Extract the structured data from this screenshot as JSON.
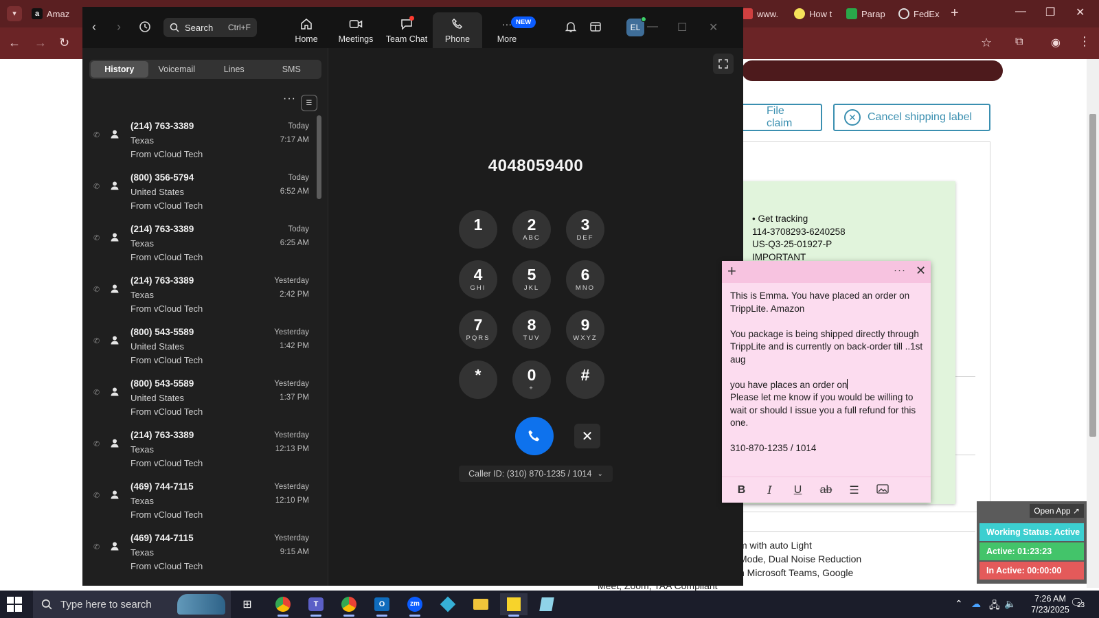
{
  "browser": {
    "tabs": [
      {
        "label": "Amaz",
        "color": "#111111"
      },
      {
        "label": "www.",
        "color": "#d04040"
      },
      {
        "label": "How t",
        "color": "#f5e25a"
      },
      {
        "label": "Parap",
        "color": "#2aa84a"
      },
      {
        "label": "FedEx",
        "color": "#e0e0e0"
      }
    ],
    "new_tab_label": "+"
  },
  "background_page": {
    "file_claim_label": "File claim",
    "cancel_label_btn": "Cancel shipping label",
    "features": [
      "m with auto Light",
      "Mode, Dual Noise Reduction",
      "h Microsoft Teams, Google"
    ],
    "bottom_text": "Meet, Zoom, TAA Compliant"
  },
  "green_note": {
    "lines": [
      "• Get tracking",
      "114-3708293-6240258",
      "US-Q3-25-01927-P",
      "IMPORTANT"
    ]
  },
  "status_widget": {
    "open_app": "Open App ↗",
    "working_status": "Working Status: Active",
    "active": "Active: 01:23:23",
    "inactive": "In Active: 00:00:00",
    "colors": {
      "working": "#3ccfd0",
      "active": "#43c46a",
      "inactive": "#e45a5a"
    }
  },
  "zoom": {
    "search_label": "Search",
    "search_shortcut": "Ctrl+F",
    "nav": [
      {
        "label": "Home"
      },
      {
        "label": "Meetings"
      },
      {
        "label": "Team Chat"
      },
      {
        "label": "Phone"
      },
      {
        "label": "More"
      }
    ],
    "new_badge": "NEW",
    "avatar_initials": "EL",
    "tabs": [
      "History",
      "Voicemail",
      "Lines",
      "SMS"
    ],
    "history": [
      {
        "number": "(214) 763-3389",
        "location": "Texas",
        "from": "From vCloud Tech",
        "day": "Today",
        "time": "7:17 AM"
      },
      {
        "number": "(800) 356-5794",
        "location": "United States",
        "from": "From vCloud Tech",
        "day": "Today",
        "time": "6:52 AM"
      },
      {
        "number": "(214) 763-3389",
        "location": "Texas",
        "from": "From vCloud Tech",
        "day": "Today",
        "time": "6:25 AM"
      },
      {
        "number": "(214) 763-3389",
        "location": "Texas",
        "from": "From vCloud Tech",
        "day": "Yesterday",
        "time": "2:42 PM"
      },
      {
        "number": "(800) 543-5589",
        "location": "United States",
        "from": "From vCloud Tech",
        "day": "Yesterday",
        "time": "1:42 PM"
      },
      {
        "number": "(800) 543-5589",
        "location": "United States",
        "from": "From vCloud Tech",
        "day": "Yesterday",
        "time": "1:37 PM"
      },
      {
        "number": "(214) 763-3389",
        "location": "Texas",
        "from": "From vCloud Tech",
        "day": "Yesterday",
        "time": "12:13 PM"
      },
      {
        "number": "(469) 744-7115",
        "location": "Texas",
        "from": "From vCloud Tech",
        "day": "Yesterday",
        "time": "12:10 PM"
      },
      {
        "number": "(469) 744-7115",
        "location": "Texas",
        "from": "From vCloud Tech",
        "day": "Yesterday",
        "time": "9:15 AM"
      }
    ],
    "dialer": {
      "number": "4048059400",
      "keys": [
        {
          "digit": "1",
          "letters": ""
        },
        {
          "digit": "2",
          "letters": "ABC"
        },
        {
          "digit": "3",
          "letters": "DEF"
        },
        {
          "digit": "4",
          "letters": "GHI"
        },
        {
          "digit": "5",
          "letters": "JKL"
        },
        {
          "digit": "6",
          "letters": "MNO"
        },
        {
          "digit": "7",
          "letters": "PQRS"
        },
        {
          "digit": "8",
          "letters": "TUV"
        },
        {
          "digit": "9",
          "letters": "WXYZ"
        },
        {
          "digit": "*",
          "letters": ""
        },
        {
          "digit": "0",
          "letters": "+"
        },
        {
          "digit": "#",
          "letters": ""
        }
      ],
      "caller_id": "Caller ID: (310) 870-1235 / 1014"
    }
  },
  "sticky_note": {
    "paragraphs": [
      "This is Emma. You have placed an order on TrippLite.        Amazon",
      "",
      "You package is being shipped directly through TrippLite and is currently on back-order till ..1st aug",
      "",
      "you have places an order on",
      "Please let me know if you would be willing to wait or should I issue you a full refund for this one.",
      "",
      "310-870-1235 / 1014"
    ],
    "caret_paragraph": 4
  },
  "taskbar": {
    "search_placeholder": "Type here to search",
    "time": "7:26 AM",
    "date": "7/23/2025",
    "notification_count": "23"
  }
}
